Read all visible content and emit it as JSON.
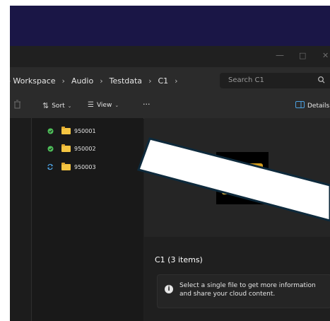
{
  "window": {
    "minimize_glyph": "—",
    "maximize_glyph": "□",
    "close_glyph": "✕"
  },
  "address": {
    "crumbs": [
      "Workspace",
      "Audio",
      "Testdata",
      "C1"
    ],
    "separator": "›",
    "search_placeholder": "Search C1"
  },
  "toolbar": {
    "sort_label": "Sort",
    "view_label": "View",
    "more_label": "···",
    "details_label": "Details"
  },
  "files": [
    {
      "name": "950001",
      "status": "synced"
    },
    {
      "name": "950002",
      "status": "synced"
    },
    {
      "name": "950003",
      "status": "syncing"
    }
  ],
  "details": {
    "title": "C1 (3 items)",
    "info_text": "Select a single file to get more information and share your cloud content."
  },
  "colors": {
    "accent": "#4ca0e0",
    "synced": "#4ec15a",
    "folder": "#f5c542",
    "header": "#1a1646"
  }
}
